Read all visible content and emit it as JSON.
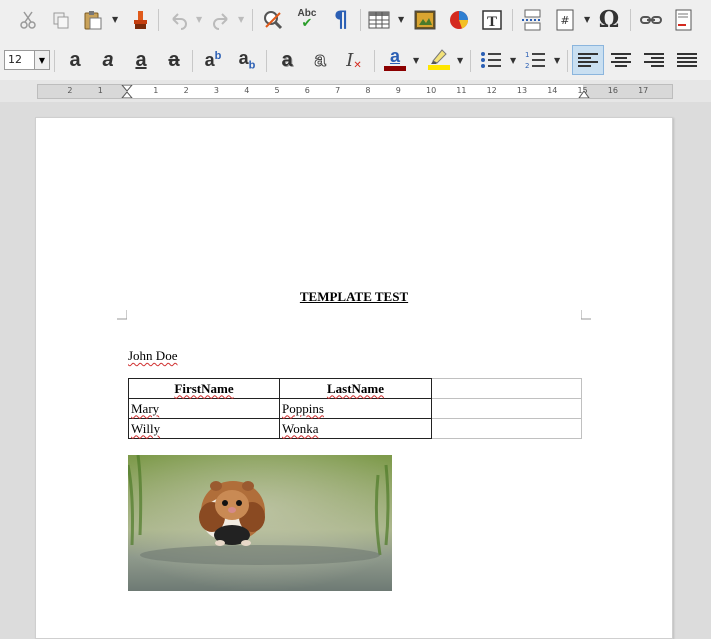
{
  "toolbar_top": {
    "items": [
      "cut-icon",
      "copy-icon",
      "paste-icon",
      "clone-formatting-icon",
      "undo-icon",
      "redo-icon",
      "find-replace-icon",
      "spelling-icon",
      "formatting-marks-icon",
      "insert-table-icon",
      "insert-image-icon",
      "insert-chart-icon",
      "insert-text-box-icon",
      "insert-page-break-icon",
      "insert-field-icon",
      "special-character-icon",
      "hyperlink-icon",
      "insert-footnote-icon"
    ],
    "spelling_label": "Abc",
    "omega_glyph": "Ω"
  },
  "toolbar_format": {
    "font_size": "12",
    "colors": {
      "font_color": "#8b0000",
      "highlight_color": "#ffe600",
      "align_active_bg": "#c9dff1"
    }
  },
  "ruler": {
    "numbers": [
      "2",
      "1",
      "1",
      "2",
      "3",
      "4",
      "5",
      "6",
      "7",
      "8",
      "9",
      "10",
      "11",
      "12",
      "13",
      "14",
      "15",
      "16",
      "17"
    ]
  },
  "document": {
    "title": "TEMPLATE TEST",
    "author": "John Doe",
    "table": {
      "headers": [
        "FirstName",
        "LastName"
      ],
      "rows": [
        [
          "Mary",
          "Poppins"
        ],
        [
          "Willy",
          "Wonka"
        ]
      ]
    },
    "image": "hamster-photo"
  }
}
